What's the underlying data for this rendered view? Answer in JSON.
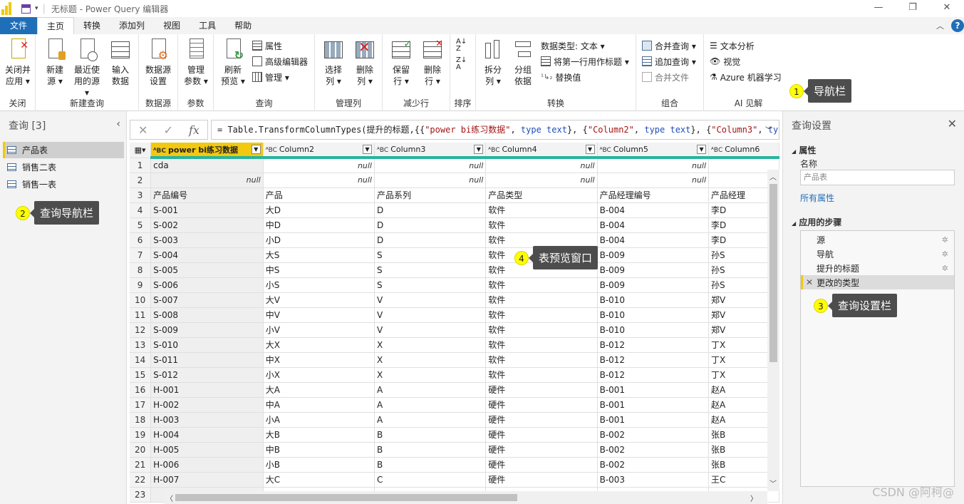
{
  "window": {
    "title": "无标题 - Power Query 编辑器"
  },
  "menu": {
    "tabs": [
      "文件",
      "主页",
      "转换",
      "添加列",
      "视图",
      "工具",
      "帮助"
    ],
    "active_index": 1
  },
  "ribbon": {
    "groups": {
      "close": {
        "name": "关闭",
        "close_apply": "关闭并\n应用 ▾"
      },
      "new_query": {
        "name": "新建查询",
        "new_source": "新建\n源 ▾",
        "recent_sources": "最近使\n用的源 ▾",
        "enter_data": "输入\n数据"
      },
      "data_source": {
        "name": "数据源",
        "settings": "数据源\n设置"
      },
      "params": {
        "name": "参数",
        "manage": "管理\n参数 ▾"
      },
      "query": {
        "name": "查询",
        "refresh": "刷新\n预览 ▾",
        "properties": "属性",
        "advanced_editor": "高级编辑器",
        "manage": "管理 ▾"
      },
      "manage_columns": {
        "name": "管理列",
        "choose": "选择\n列 ▾",
        "remove": "删除\n列 ▾"
      },
      "reduce_rows": {
        "name": "减少行",
        "keep": "保留\n行 ▾",
        "remove": "删除\n行 ▾"
      },
      "sort": {
        "name": "排序"
      },
      "transform": {
        "name": "转换",
        "split": "拆分\n列 ▾",
        "group_by": "分组\n依据",
        "data_type": "数据类型: 文本 ▾",
        "use_first_row": "将第一行用作标题 ▾",
        "replace": "替换值"
      },
      "combine": {
        "name": "组合",
        "merge": "合并查询 ▾",
        "append": "追加查询 ▾",
        "combine_files": "合并文件"
      },
      "ai": {
        "name": "AI 见解",
        "text_analytics": "文本分析",
        "vision": "视觉",
        "azure_ml": "Azure 机器学习"
      }
    }
  },
  "formula": {
    "fx": "fx",
    "prefix": "= Table.TransformColumnTypes(提升的标题,{{",
    "s1": "\"power bi练习数据\"",
    "t1": "type",
    "t1b": "text",
    "s2": "\"Column2\"",
    "s3": "\"Column3\""
  },
  "queries": {
    "header": "查询 [3]",
    "items": [
      "产品表",
      "销售二表",
      "销售一表"
    ],
    "selected_index": 0
  },
  "table": {
    "columns": [
      "power bi练习数据",
      "Column2",
      "Column3",
      "Column4",
      "Column5",
      "Column6"
    ],
    "rows": [
      [
        "cda",
        "null",
        "null",
        "null",
        "null",
        ""
      ],
      [
        "null",
        "null",
        "null",
        "null",
        "null",
        ""
      ],
      [
        "产品编号",
        "产品",
        "产品系列",
        "产品类型",
        "产品经理编号",
        "产品经理"
      ],
      [
        "S-001",
        "大D",
        "D",
        "软件",
        "B-004",
        "李D"
      ],
      [
        "S-002",
        "中D",
        "D",
        "软件",
        "B-004",
        "李D"
      ],
      [
        "S-003",
        "小D",
        "D",
        "软件",
        "B-004",
        "李D"
      ],
      [
        "S-004",
        "大S",
        "S",
        "软件",
        "B-009",
        "孙S"
      ],
      [
        "S-005",
        "中S",
        "S",
        "软件",
        "B-009",
        "孙S"
      ],
      [
        "S-006",
        "小S",
        "S",
        "软件",
        "B-009",
        "孙S"
      ],
      [
        "S-007",
        "大V",
        "V",
        "软件",
        "B-010",
        "郑V"
      ],
      [
        "S-008",
        "中V",
        "V",
        "软件",
        "B-010",
        "郑V"
      ],
      [
        "S-009",
        "小V",
        "V",
        "软件",
        "B-010",
        "郑V"
      ],
      [
        "S-010",
        "大X",
        "X",
        "软件",
        "B-012",
        "丁X"
      ],
      [
        "S-011",
        "中X",
        "X",
        "软件",
        "B-012",
        "丁X"
      ],
      [
        "S-012",
        "小X",
        "X",
        "软件",
        "B-012",
        "丁X"
      ],
      [
        "H-001",
        "大A",
        "A",
        "硬件",
        "B-001",
        "赵A"
      ],
      [
        "H-002",
        "中A",
        "A",
        "硬件",
        "B-001",
        "赵A"
      ],
      [
        "H-003",
        "小A",
        "A",
        "硬件",
        "B-001",
        "赵A"
      ],
      [
        "H-004",
        "大B",
        "B",
        "硬件",
        "B-002",
        "张B"
      ],
      [
        "H-005",
        "中B",
        "B",
        "硬件",
        "B-002",
        "张B"
      ],
      [
        "H-006",
        "小B",
        "B",
        "硬件",
        "B-002",
        "张B"
      ],
      [
        "H-007",
        "大C",
        "C",
        "硬件",
        "B-003",
        "王C"
      ],
      [
        "",
        "",
        "",
        "",
        "",
        ""
      ]
    ]
  },
  "settings": {
    "header": "查询设置",
    "properties_title": "属性",
    "name_label": "名称",
    "name_value": "产品表",
    "all_properties": "所有属性",
    "steps_title": "应用的步骤",
    "steps": [
      "源",
      "导航",
      "提升的标题",
      "更改的类型"
    ],
    "selected_step": 3
  },
  "callouts": [
    {
      "num": "1",
      "label": "导航栏"
    },
    {
      "num": "2",
      "label": "查询导航栏"
    },
    {
      "num": "3",
      "label": "查询设置栏"
    },
    {
      "num": "4",
      "label": "表预览窗口"
    }
  ],
  "watermark": "CSDN @阿柯@",
  "colors": {
    "accent": "#f2c811",
    "file_tab": "#1f6fb8",
    "column_quality": "#27b4a0"
  }
}
